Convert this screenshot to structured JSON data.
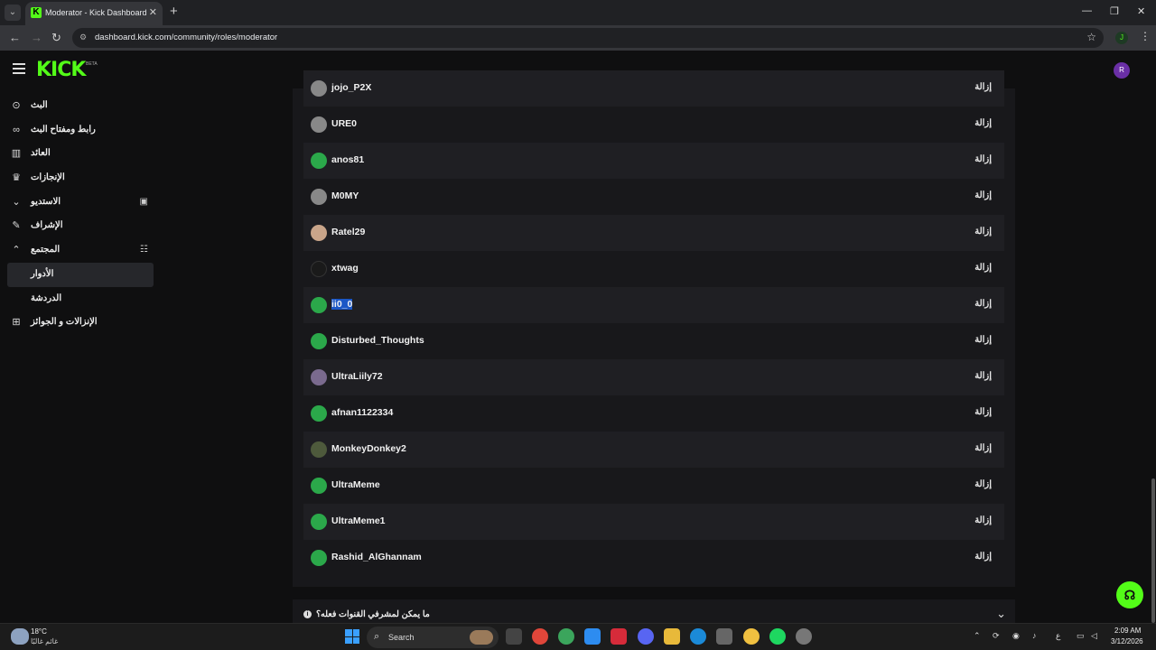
{
  "browser": {
    "tab_title": "Moderator - Kick Dashboard",
    "url": "dashboard.kick.com/community/roles/moderator",
    "profile_initial": "J"
  },
  "header": {
    "logo": "KICK",
    "beta": "BETA",
    "avatar_initial": "R"
  },
  "sidebar": {
    "items": [
      {
        "label": "البث",
        "icon": "broadcast-icon"
      },
      {
        "label": "رابط ومفتاح البث",
        "icon": "link-icon"
      },
      {
        "label": "العائد",
        "icon": "chart-icon"
      },
      {
        "label": "الإنجازات",
        "icon": "trophy-icon"
      },
      {
        "label": "الاستديو",
        "icon": "chevron-down-icon"
      },
      {
        "label": "الإشراف",
        "icon": "wrench-icon"
      },
      {
        "label": "المجتمع",
        "icon": "chevron-up-icon"
      },
      {
        "label": "الأدوار",
        "icon": ""
      },
      {
        "label": "الدردشة",
        "icon": ""
      },
      {
        "label": "الإنزالات و الجوائز",
        "icon": "gift-icon"
      }
    ]
  },
  "moderators": {
    "remove_label": "إزالة",
    "rows": [
      {
        "name": "jojo_P2X"
      },
      {
        "name": "URE0"
      },
      {
        "name": "anos81"
      },
      {
        "name": "M0MY"
      },
      {
        "name": "Ratel29"
      },
      {
        "name": "xtwag"
      },
      {
        "name": "ii0_0"
      },
      {
        "name": "Disturbed_Thoughts"
      },
      {
        "name": "UltraLiily72"
      },
      {
        "name": "afnan1122334"
      },
      {
        "name": "MonkeyDonkey2"
      },
      {
        "name": "UltraMeme"
      },
      {
        "name": "UltraMeme1"
      },
      {
        "name": "Rashid_AlGhannam"
      }
    ]
  },
  "faq": {
    "question": "ما يمكن لمشرفي القنوات فعله؟"
  },
  "taskbar": {
    "temperature": "18°C",
    "weather": "غائم غالبًا",
    "search_label": "Search",
    "time": "2:09 AM",
    "date": "3/12/2026",
    "lang": "ع"
  },
  "colors": {
    "brand": "#53fc18",
    "panel": "#18181b",
    "row_alt": "#1f1f23",
    "selection": "#1b57c6"
  }
}
